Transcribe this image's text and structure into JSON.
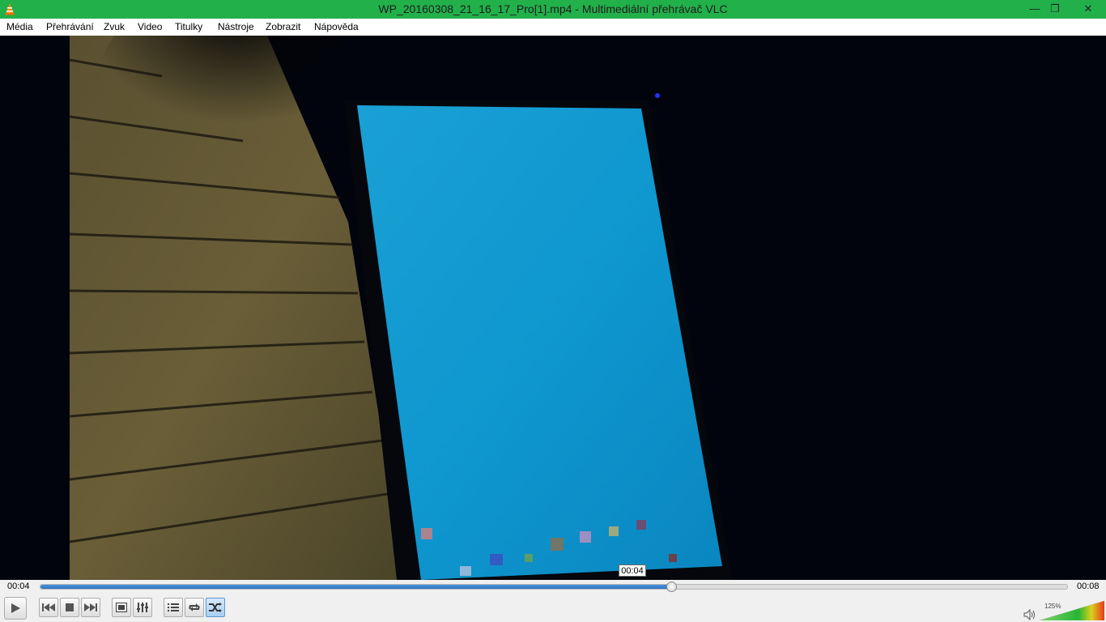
{
  "window": {
    "title": "WP_20160308_21_16_17_Pro[1].mp4 - Multimediální přehrávač VLC",
    "minimize_glyph": "—",
    "maximize_glyph": "❐",
    "close_glyph": "✕"
  },
  "menu": {
    "items": [
      "Média",
      "Přehrávání",
      "Zvuk",
      "Video",
      "Titulky",
      "Nástroje",
      "Zobrazit",
      "Nápověda"
    ]
  },
  "player": {
    "elapsed": "00:04",
    "total": "00:08",
    "progress_fraction": 0.614,
    "seek_tooltip": "00:04",
    "volume_label": "125%",
    "volume_fraction": 1.0
  },
  "icons": {
    "app": "vlc-cone-icon",
    "play": "play-icon",
    "prev": "previous-icon",
    "stop": "stop-icon",
    "next": "next-icon",
    "fullscreen": "fullscreen-icon",
    "extended": "extended-settings-icon",
    "playlist": "playlist-icon",
    "loop": "loop-icon",
    "random": "shuffle-icon",
    "volume": "speaker-icon"
  },
  "colors": {
    "titlebar": "#22b04b",
    "seek_fill": "#3a82d0",
    "video_bg": "#02040d"
  }
}
